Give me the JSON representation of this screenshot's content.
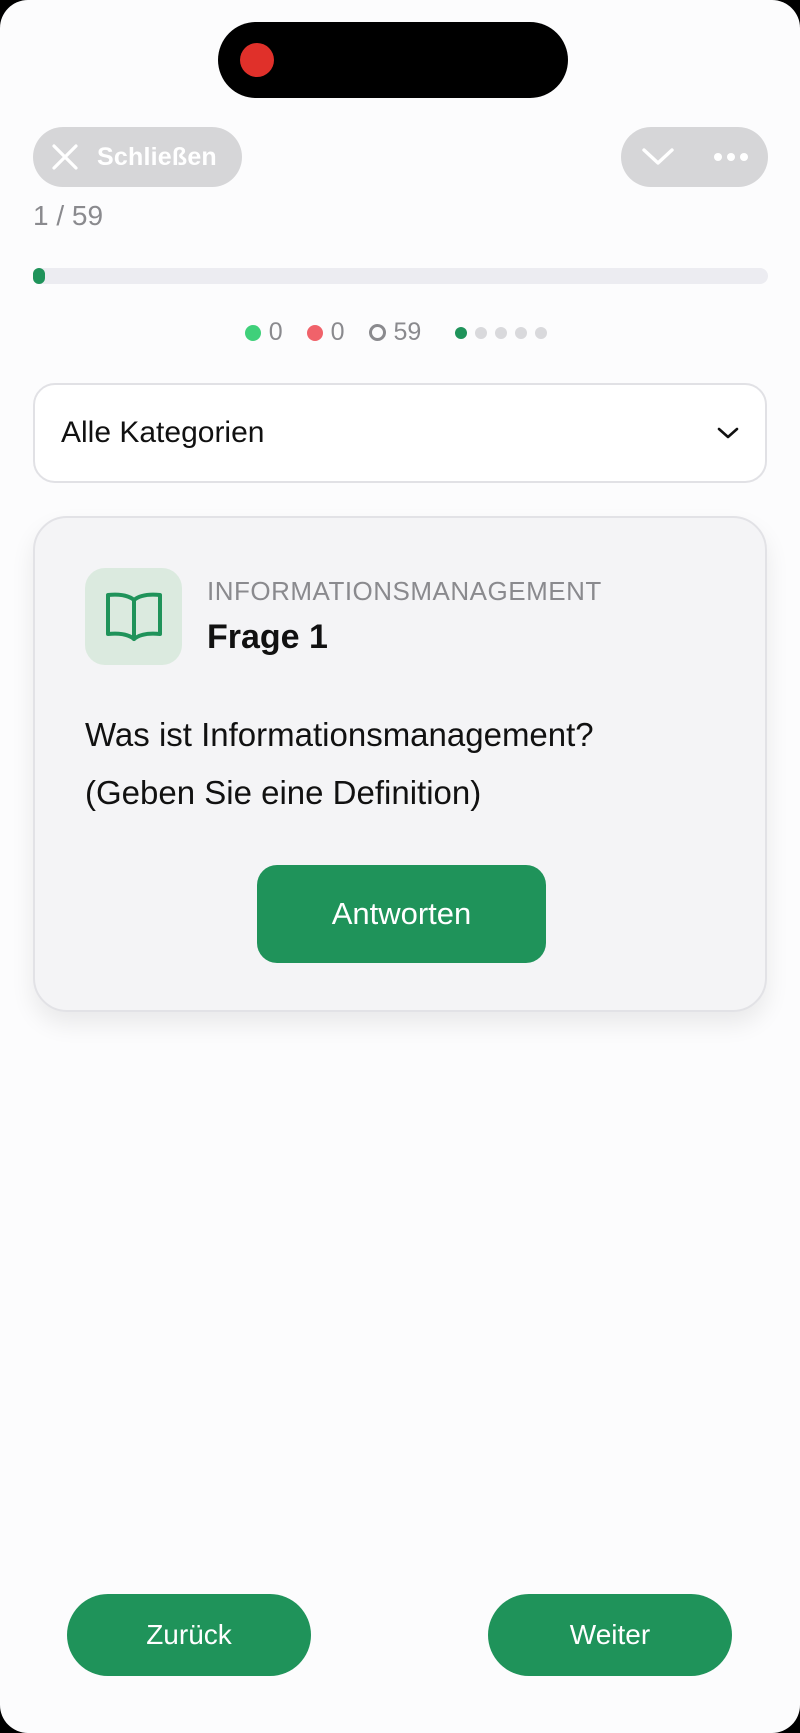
{
  "header": {
    "close_label": "Schließen",
    "counter": "1 / 59"
  },
  "progress": {
    "fraction": 0.017
  },
  "stats": {
    "correct": "0",
    "wrong": "0",
    "open": "59",
    "colors": {
      "correct": "#3fd07a",
      "wrong": "#f0626a",
      "accent": "#1f935a"
    }
  },
  "filter": {
    "selected": "Alle Kategorien"
  },
  "card": {
    "category": "INFORMATIONSMANAGEMENT",
    "title": "Frage 1",
    "question_line1": "Was ist Informationsmanagement?",
    "question_line2": "(Geben Sie eine Definition)",
    "answer_label": "Antworten",
    "icon": "book-icon"
  },
  "footer": {
    "back_label": "Zurück",
    "next_label": "Weiter"
  }
}
